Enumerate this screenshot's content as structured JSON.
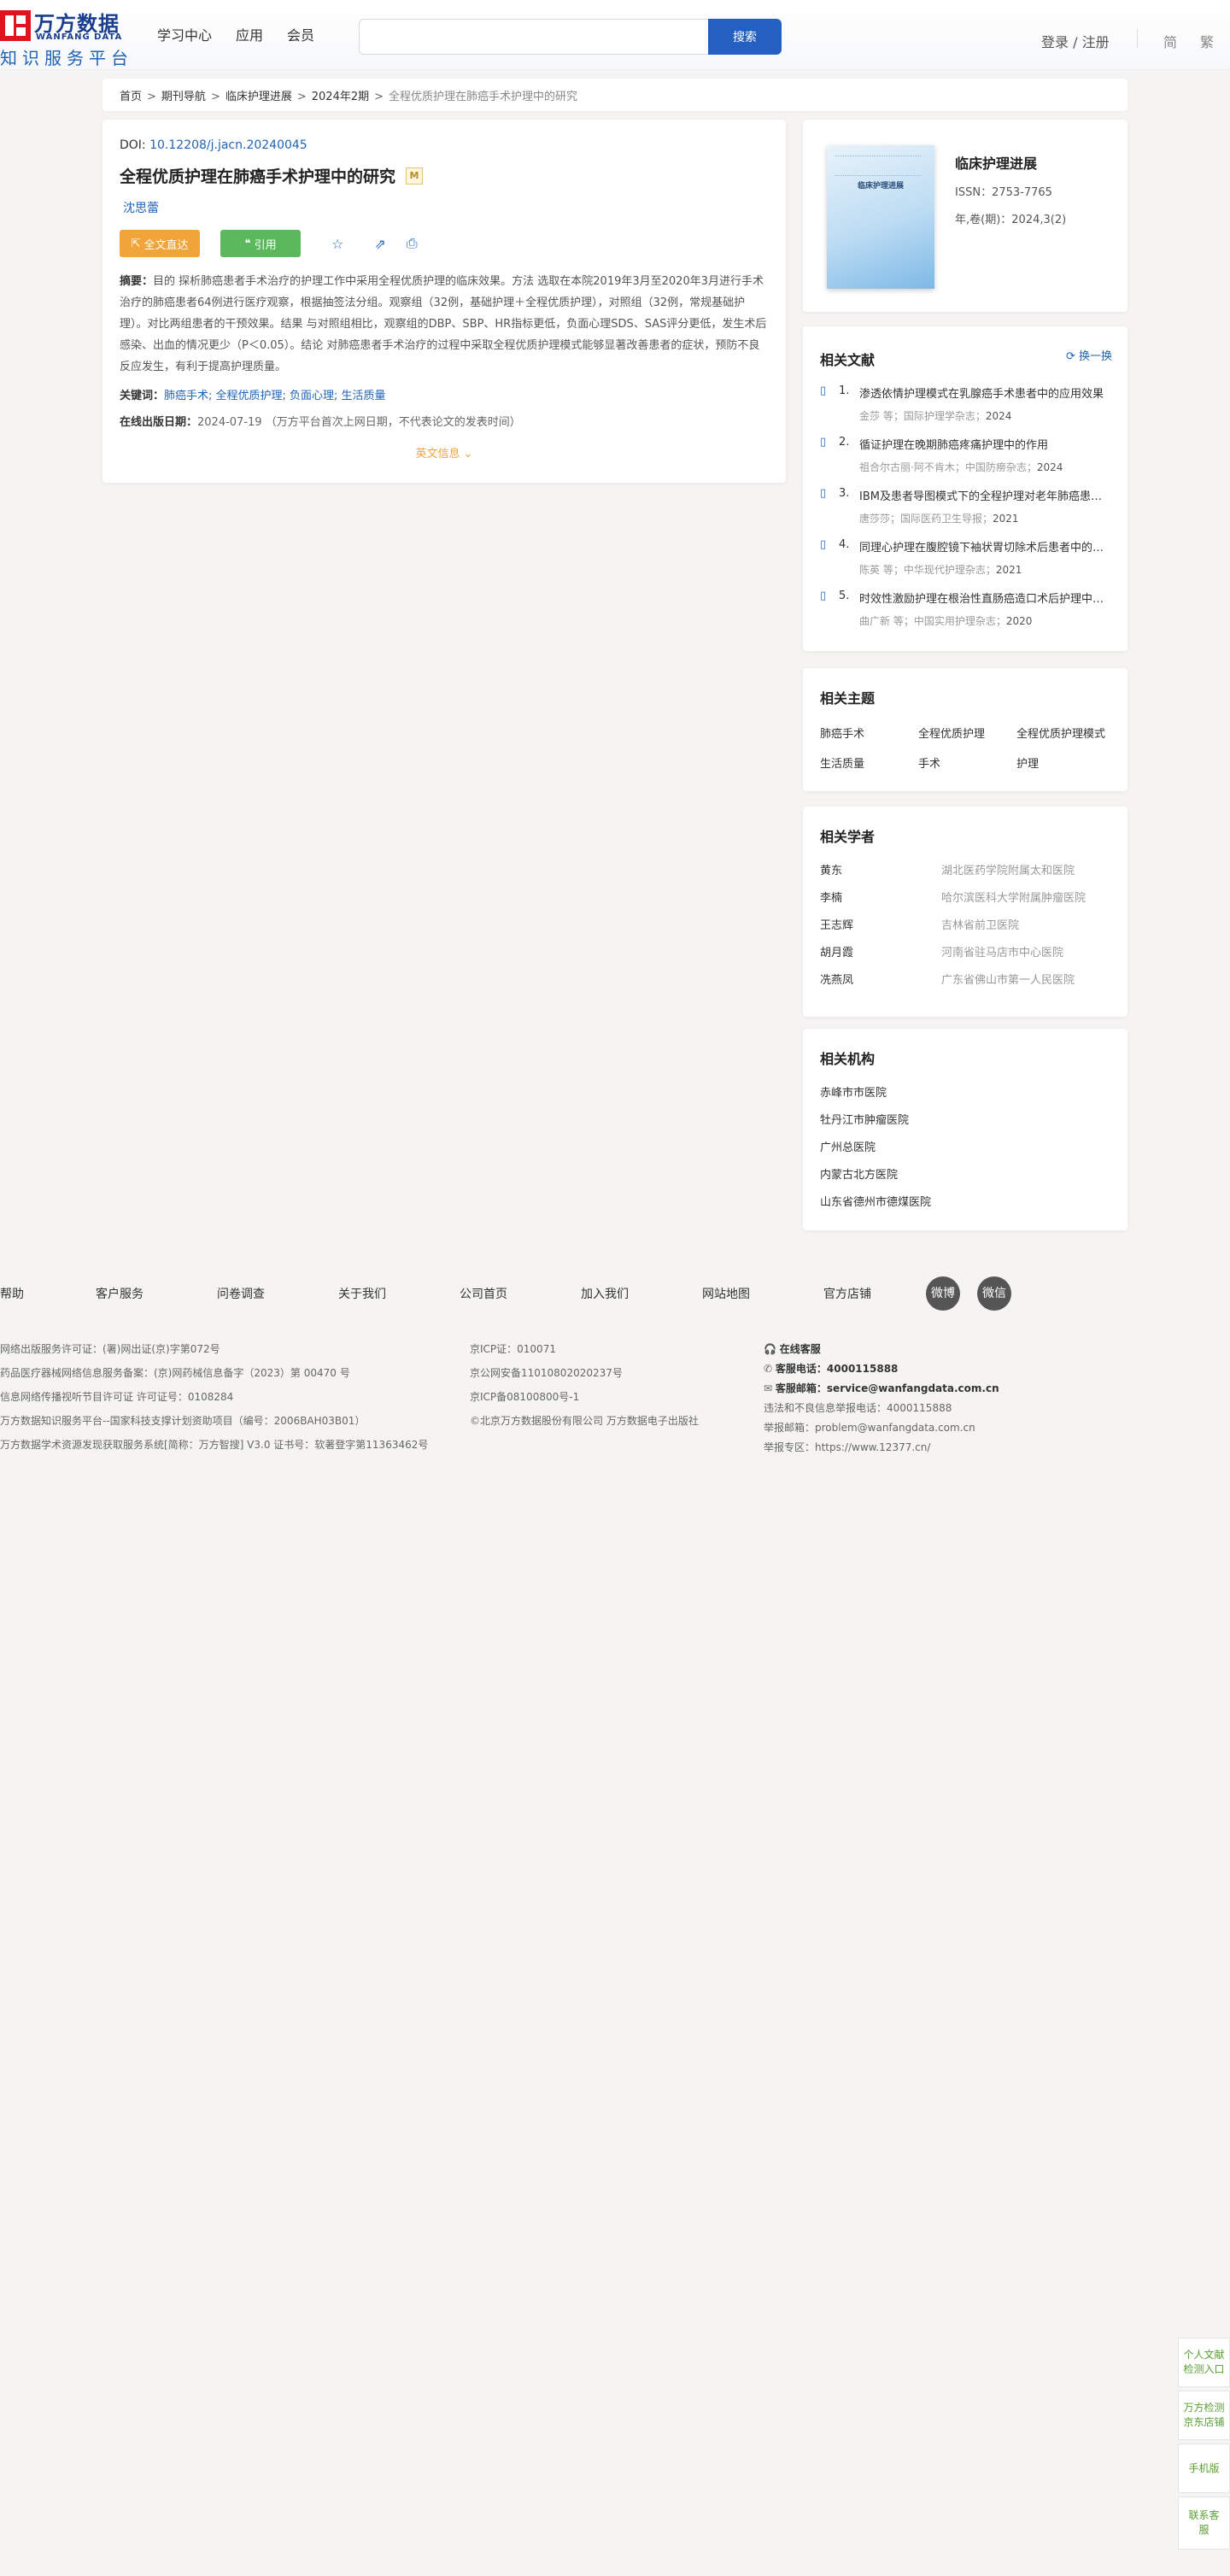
{
  "header": {
    "logo_cn": "万方数据",
    "logo_en": "WANFANG DATA",
    "logo_sub": "知识服务平台",
    "nav": [
      "学习中心",
      "应用",
      "会员"
    ],
    "search_placeholder": "",
    "search_button": "搜索",
    "login": "登录 / 注册",
    "lang_simplified": "简",
    "lang_traditional": "繁"
  },
  "breadcrumb": [
    "首页",
    "期刊导航",
    "临床护理进展",
    "2024年2期",
    "全程优质护理在肺癌手术护理中的研究"
  ],
  "article": {
    "doi_label": "DOI:",
    "doi": "10.12208/j.jacn.20240045",
    "title": "全程优质护理在肺癌手术护理中的研究",
    "badge": "M",
    "author": "沈思蕾",
    "btn_fulltext": "全文直达",
    "btn_cite": "引用",
    "abstract_label": "摘要：",
    "abstract": "目的 探析肺癌患者手术治疗的护理工作中采用全程优质护理的临床效果。方法 选取在本院2019年3月至2020年3月进行手术治疗的肺癌患者64例进行医疗观察，根据抽签法分组。观察组（32例，基础护理＋全程优质护理），对照组（32例，常规基础护理）。对比两组患者的干预效果。结果 与对照组相比，观察组的DBP、SBP、HR指标更低，负面心理SDS、SAS评分更低，发生术后感染、出血的情况更少（P＜0.05）。结论 对肺癌患者手术治疗的过程中采取全程优质护理模式能够显著改善患者的症状，预防不良反应发生，有利于提高护理质量。",
    "keywords_label": "关键词：",
    "keywords": "肺癌手术; 全程优质护理; 负面心理; 生活质量",
    "pubdate_label": "在线出版日期：",
    "pubdate": "2024-07-19 （万方平台首次上网日期，不代表论文的发表时间）",
    "more": "英文信息"
  },
  "journal": {
    "cover_title": "临床护理进展",
    "name": "临床护理进展",
    "issn": "ISSN：2753-7765",
    "vol": "年,卷(期)：2024,3(2)"
  },
  "related": {
    "title": "相关文献",
    "swap": "换一换",
    "items": [
      {
        "num": "1.",
        "title": "渗透依情护理模式在乳腺癌手术患者中的应用效果",
        "meta": "金莎  等；国际护理学杂志；",
        "year": "2024"
      },
      {
        "num": "2.",
        "title": "循证护理在晚期肺癌疼痛护理中的作用",
        "meta": "祖合尔古丽·阿不肯木；中国防痨杂志；",
        "year": "2024"
      },
      {
        "num": "3.",
        "title": "IBM及患者导图模式下的全程护理对老年肺癌患者的影响",
        "meta": "唐莎莎；国际医药卫生导报；",
        "year": "2021"
      },
      {
        "num": "4.",
        "title": "同理心护理在腹腔镜下袖状胃切除术后患者中的应用",
        "meta": "陈英  等；中华现代护理杂志；",
        "year": "2021"
      },
      {
        "num": "5.",
        "title": "时效性激励护理在根治性直肠癌造口术后护理中的应用",
        "meta": "曲广新  等；中国实用护理杂志；",
        "year": "2020"
      }
    ]
  },
  "topics": {
    "title": "相关主题",
    "items": [
      "肺癌手术",
      "全程优质护理",
      "全程优质护理模式",
      "生活质量",
      "手术",
      "护理"
    ]
  },
  "scholars": {
    "title": "相关学者",
    "items": [
      {
        "name": "黄东",
        "org": "湖北医药学院附属太和医院"
      },
      {
        "name": "李楠",
        "org": "哈尔滨医科大学附属肿瘤医院"
      },
      {
        "name": "王志辉",
        "org": "吉林省前卫医院"
      },
      {
        "name": "胡月霞",
        "org": "河南省驻马店市中心医院"
      },
      {
        "name": "冼燕凤",
        "org": "广东省佛山市第一人民医院"
      }
    ]
  },
  "orgs": {
    "title": "相关机构",
    "items": [
      "赤峰市市医院",
      "牡丹江市肿瘤医院",
      "广州总医院",
      "内蒙古北方医院",
      "山东省德州市德煤医院"
    ]
  },
  "footer": {
    "nav": [
      "帮助",
      "客户服务",
      "问卷调查",
      "关于我们",
      "公司首页",
      "加入我们",
      "网站地图",
      "官方店铺"
    ],
    "weibo": "微博",
    "wechat": "微信",
    "col1": [
      "网络出版服务许可证：(署)网出证(京)字第072号",
      "药品医疗器械网络信息服务备案：(京)网药械信息备字（2023）第 00470 号",
      "信息网络传播视听节目许可证 许可证号：0108284",
      "万方数据知识服务平台--国家科技支撑计划资助项目（编号：2006BAH03B01）",
      "万方数据学术资源发现获取服务系统[简称：万方智搜] V3.0 证书号：软著登字第11363462号"
    ],
    "col2": [
      "京ICP证：010071",
      "京公网安备11010802020237号",
      "京ICP备08100800号-1",
      "©北京万方数据股份有限公司 万方数据电子出版社"
    ],
    "col3": {
      "online": "在线客服",
      "phone_label": "客服电话：",
      "phone": "4000115888",
      "email_label": "客服邮箱：",
      "email": "service@wanfangdata.com.cn",
      "report_phone": "违法和不良信息举报电话：4000115888",
      "report_email": "举报邮箱：problem@wanfangdata.com.cn",
      "report_zone": "举报专区：https://www.12377.cn/"
    }
  },
  "side": [
    "个人文献检测入口",
    "万方检测京东店铺",
    "手机版",
    "联系客服"
  ]
}
